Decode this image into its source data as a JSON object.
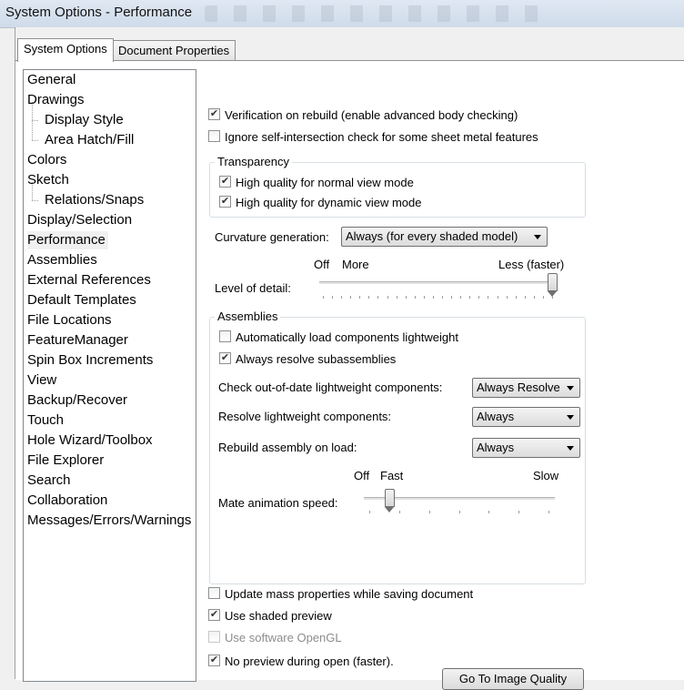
{
  "window": {
    "title": "System Options - Performance"
  },
  "tabs": [
    {
      "label": "System Options",
      "active": true
    },
    {
      "label": "Document Properties",
      "active": false
    }
  ],
  "nav": {
    "selected": "Performance",
    "items": [
      {
        "label": "General"
      },
      {
        "label": "Drawings"
      },
      {
        "label": "Display Style"
      },
      {
        "label": "Area Hatch/Fill"
      },
      {
        "label": "Colors"
      },
      {
        "label": "Sketch"
      },
      {
        "label": "Relations/Snaps"
      },
      {
        "label": "Display/Selection"
      },
      {
        "label": "Performance"
      },
      {
        "label": "Assemblies"
      },
      {
        "label": "External References"
      },
      {
        "label": "Default Templates"
      },
      {
        "label": "File Locations"
      },
      {
        "label": "FeatureManager"
      },
      {
        "label": "Spin Box Increments"
      },
      {
        "label": "View"
      },
      {
        "label": "Backup/Recover"
      },
      {
        "label": "Touch"
      },
      {
        "label": "Hole Wizard/Toolbox"
      },
      {
        "label": "File Explorer"
      },
      {
        "label": "Search"
      },
      {
        "label": "Collaboration"
      },
      {
        "label": "Messages/Errors/Warnings"
      }
    ]
  },
  "options": {
    "verification": {
      "label": "Verification on rebuild (enable advanced body checking)",
      "checked": true
    },
    "ignore_self_intersection": {
      "label": "Ignore self-intersection check for some sheet metal features",
      "checked": false
    }
  },
  "transparency": {
    "legend": "Transparency",
    "normal": {
      "label": "High quality for normal view mode",
      "checked": true
    },
    "dynamic": {
      "label": "High quality for dynamic view mode",
      "checked": true
    }
  },
  "curvature": {
    "label": "Curvature generation:",
    "value": "Always (for every shaded model)"
  },
  "level_of_detail": {
    "label": "Level of detail:",
    "off_label": "Off",
    "more_label": "More",
    "less_label": "Less (faster)",
    "value_fraction": 1.0
  },
  "assemblies": {
    "legend": "Assemblies",
    "auto_lightweight": {
      "label": "Automatically load components lightweight",
      "checked": false
    },
    "resolve_subassemblies": {
      "label": "Always resolve subassemblies",
      "checked": true
    },
    "check_out_of_date": {
      "label": "Check out-of-date lightweight components:",
      "value": "Always Resolve"
    },
    "resolve_lightweight": {
      "label": "Resolve lightweight components:",
      "value": "Always"
    },
    "rebuild_on_load": {
      "label": "Rebuild assembly on load:",
      "value": "Always"
    },
    "mate_animation": {
      "label": "Mate animation speed:",
      "off_label": "Off",
      "fast_label": "Fast",
      "slow_label": "Slow",
      "value_fraction": 0.19
    }
  },
  "bottom": {
    "update_mass": {
      "label": "Update mass properties while saving document",
      "checked": false
    },
    "shaded_preview": {
      "label": "Use shaded preview",
      "checked": true
    },
    "software_opengl": {
      "label": "Use software OpenGL",
      "checked": false,
      "disabled": true
    },
    "no_preview": {
      "label": "No preview during open (faster).",
      "checked": true
    }
  },
  "buttons": {
    "image_quality": "Go To Image Quality"
  }
}
